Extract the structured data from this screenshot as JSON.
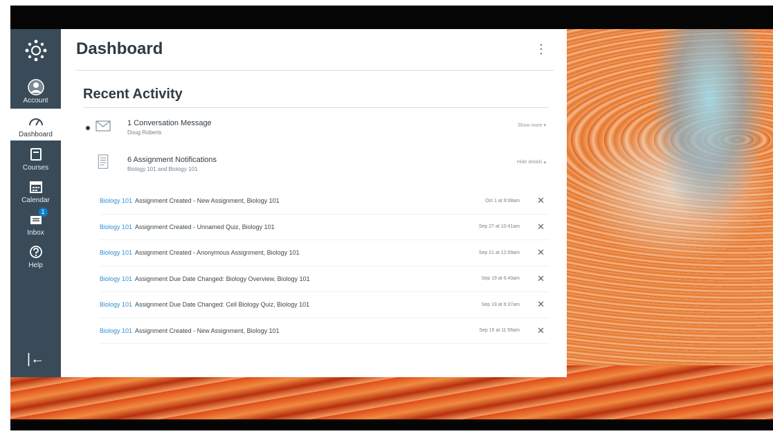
{
  "sidebar": {
    "items": [
      {
        "label": "Account",
        "icon": "account-icon",
        "active": false
      },
      {
        "label": "Dashboard",
        "icon": "dashboard-icon",
        "active": true
      },
      {
        "label": "Courses",
        "icon": "courses-icon",
        "active": false
      },
      {
        "label": "Calendar",
        "icon": "calendar-icon",
        "active": false
      },
      {
        "label": "Inbox",
        "icon": "inbox-icon",
        "active": false,
        "badge": "1"
      },
      {
        "label": "Help",
        "icon": "help-icon",
        "active": false
      }
    ],
    "collapse_glyph": "|←"
  },
  "header": {
    "title": "Dashboard",
    "menu_glyph": "⋮"
  },
  "recent_activity": {
    "title": "Recent Activity",
    "groups": [
      {
        "title": "1 Conversation Message",
        "subtitle": "Doug Roberts",
        "toggle": "Show more",
        "icon": "envelope-icon"
      },
      {
        "title": "6 Assignment Notifications",
        "subtitle": "Biology 101 and Biology 101",
        "toggle": "Hide details",
        "icon": "assignment-icon"
      }
    ],
    "items": [
      {
        "course": "Biology 101",
        "text": "Assignment Created - New Assignment, Biology 101",
        "date": "Oct 1 at 9:08am",
        "close": "✕"
      },
      {
        "course": "Biology 101",
        "text": "Assignment Created - Unnamed Quiz, Biology 101",
        "date": "Sep 27 at 10:41am",
        "close": "✕"
      },
      {
        "course": "Biology 101",
        "text": "Assignment Created - Anonymous Assignment, Biology 101",
        "date": "Sep 21 at 12:09am",
        "close": "✕"
      },
      {
        "course": "Biology 101",
        "text": "Assignment Due Date Changed: Biology Overview, Biology 101",
        "date": "Sep 19 at 6:43am",
        "close": "✕"
      },
      {
        "course": "Biology 101",
        "text": "Assignment Due Date Changed: Cell Biology Quiz, Biology 101",
        "date": "Sep 19 at 6:37am",
        "close": "✕"
      },
      {
        "course": "Biology 101",
        "text": "Assignment Created - New Assignment, Biology 101",
        "date": "Sep 15 at 11:56am",
        "close": "✕"
      }
    ]
  },
  "colors": {
    "sidebar": "#394b58",
    "link": "#2f8fd0",
    "text": "#2d3b45",
    "badge": "#0a7ecb"
  }
}
